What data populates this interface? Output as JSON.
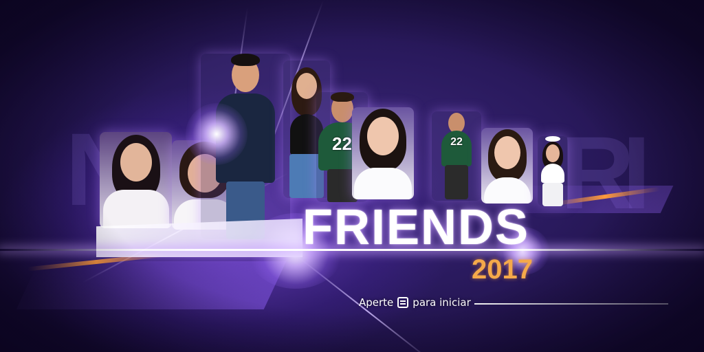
{
  "title": {
    "main": "FRIENDS",
    "year": "2017"
  },
  "prompt": {
    "before": "Aperte",
    "after": "para iniciar",
    "button_icon": "menu-button-icon"
  },
  "players": [
    {
      "id": "girl-left-1",
      "jersey": ""
    },
    {
      "id": "girl-left-2",
      "jersey": ""
    },
    {
      "id": "boy-center",
      "jersey": ""
    },
    {
      "id": "girl-selfie",
      "jersey": ""
    },
    {
      "id": "man-jersey",
      "jersey": "22"
    },
    {
      "id": "girl-center",
      "jersey": ""
    },
    {
      "id": "man-running",
      "jersey": "22"
    },
    {
      "id": "girl-right",
      "jersey": ""
    },
    {
      "id": "girl-halo",
      "jersey": ""
    }
  ],
  "colors": {
    "background": "#2a1a5e",
    "accent_orange": "#f5a94a",
    "glow": "#c8a0ff"
  }
}
